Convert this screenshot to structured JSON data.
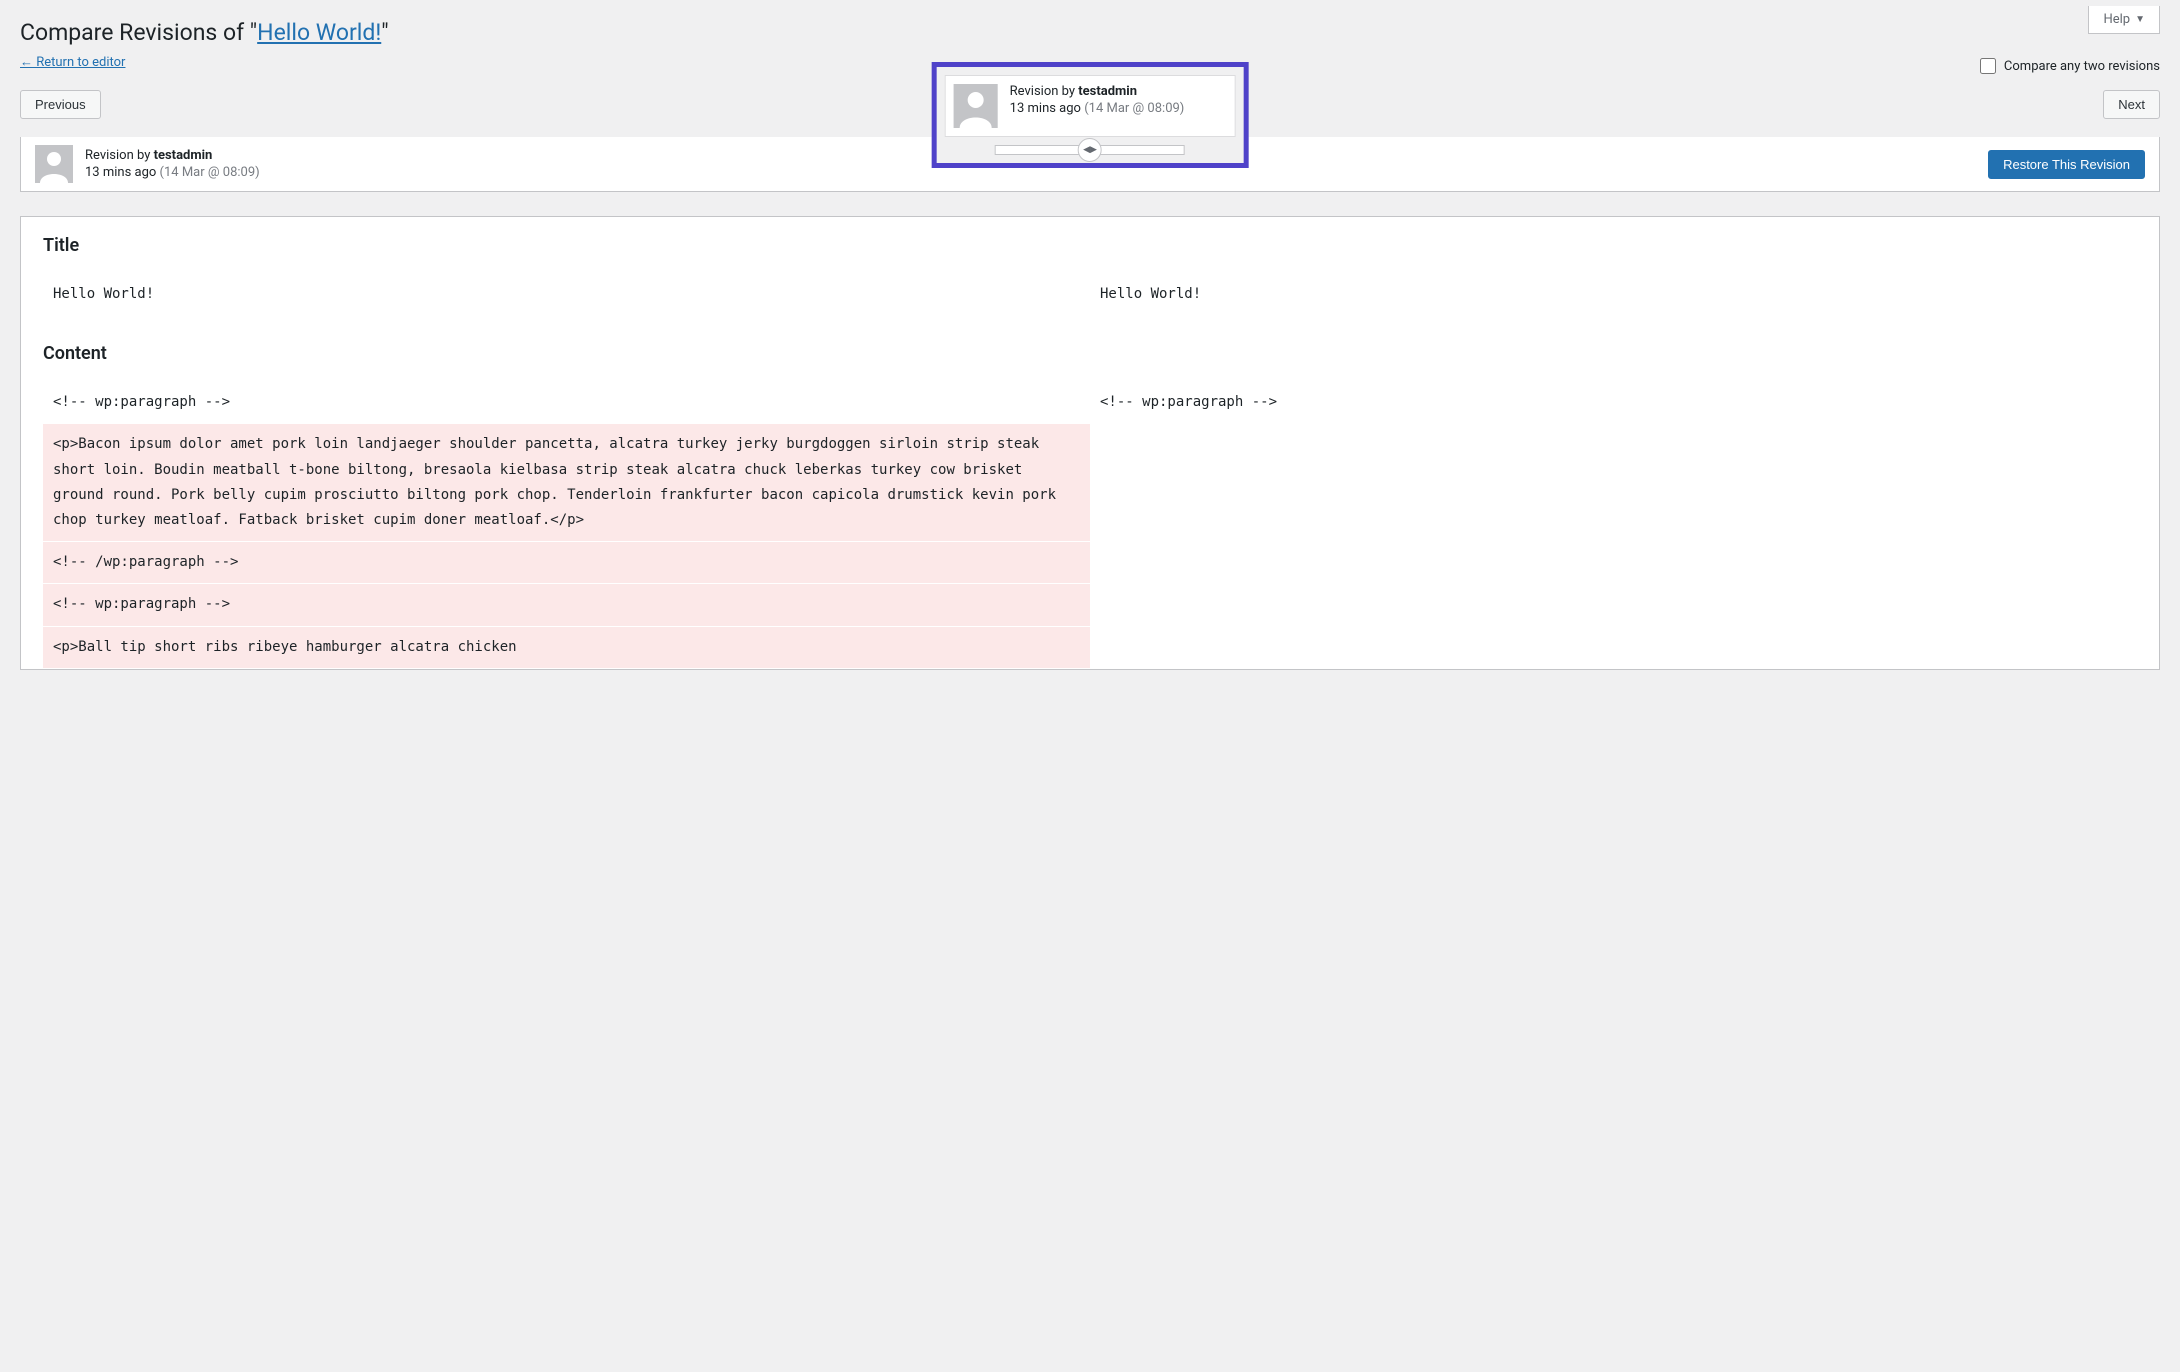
{
  "help": {
    "label": "Help"
  },
  "header": {
    "title_prefix": "Compare Revisions of \"",
    "title_link": "Hello World!",
    "title_suffix": "\"",
    "return_arrow": "←",
    "return_text": " Return to editor"
  },
  "buttons": {
    "previous": "Previous",
    "next": "Next",
    "restore": "Restore This Revision"
  },
  "compare_checkbox_label": "Compare any two revisions",
  "tooltip": {
    "prefix": "Revision by ",
    "author": "testadmin",
    "time_ago": "13 mins ago ",
    "datetime": "(14 Mar @ 08:09)"
  },
  "meta": {
    "prefix": "Revision by ",
    "author": "testadmin",
    "time_ago": "13 mins ago ",
    "datetime": "(14 Mar @ 08:09)"
  },
  "diff": {
    "title_heading": "Title",
    "title_left": "Hello World!",
    "title_right": "Hello World!",
    "content_heading": "Content",
    "rows": [
      {
        "left": "<!-- wp:paragraph -->",
        "right": "<!-- wp:paragraph -->",
        "removed": false
      },
      {
        "left": "<p>Bacon ipsum dolor amet pork loin landjaeger shoulder pancetta, alcatra turkey jerky burgdoggen sirloin strip steak short loin. Boudin meatball t-bone biltong, bresaola kielbasa strip steak alcatra chuck leberkas turkey cow brisket ground round. Pork belly cupim prosciutto biltong pork chop. Tenderloin frankfurter bacon capicola drumstick kevin pork chop turkey meatloaf. Fatback brisket cupim doner meatloaf.</p>",
        "right": "",
        "removed": true
      },
      {
        "left": "<!-- /wp:paragraph -->",
        "right": "",
        "removed": true
      },
      {
        "left": "<!-- wp:paragraph -->",
        "right": "",
        "removed": true
      },
      {
        "left": "<p>Ball tip short ribs ribeye hamburger alcatra chicken",
        "right": "",
        "removed": true
      }
    ]
  }
}
